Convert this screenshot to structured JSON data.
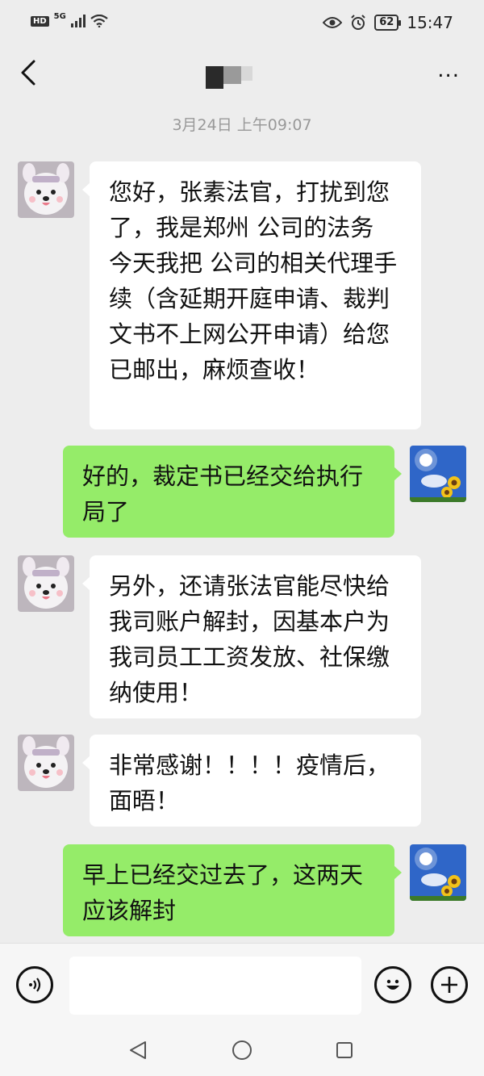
{
  "status_bar": {
    "hd_label": "HD",
    "network_label": "5G",
    "battery": "62",
    "time": "15:47"
  },
  "header": {
    "back_icon": "chevron-left-icon",
    "more_label": "..."
  },
  "timestamp": "3月24日 上午09:07",
  "messages": [
    {
      "side": "left",
      "text": "您好，张素法官，打扰到您了，我是郑州 公司的法务 今天我把 公司的相关代理手续（含延期开庭申请、裁判文书不上网公开申请）给您已邮出，麻烦查收！"
    },
    {
      "side": "right",
      "text": "好的，裁定书已经交给执行局了"
    },
    {
      "side": "left",
      "text": "另外，还请张法官能尽快给我司账户解封，因基本户为我司员工工资发放、社保缴纳使用！"
    },
    {
      "side": "left",
      "text": "非常感谢！！！！疫情后，面晤！"
    },
    {
      "side": "right",
      "text": "早上已经交过去了，这两天应该解封"
    }
  ],
  "input_bar": {
    "voice_icon": "voice-icon",
    "emoji_icon": "emoji-icon",
    "plus_icon": "plus-icon"
  },
  "colors": {
    "background": "#ededed",
    "sent_bubble": "#95ec69",
    "received_bubble": "#ffffff",
    "timestamp": "#999999"
  }
}
